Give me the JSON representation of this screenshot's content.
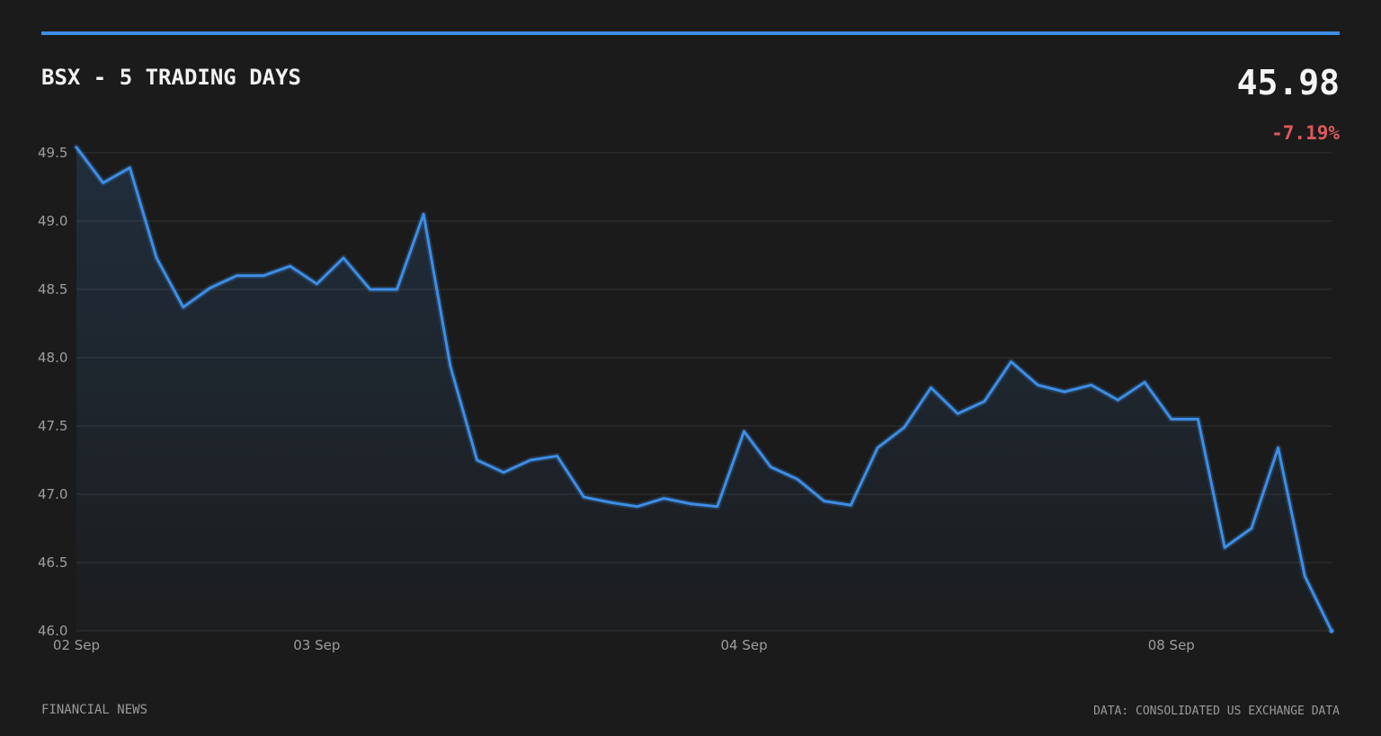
{
  "header": {
    "title": "BSX - 5 TRADING DAYS",
    "price": "45.98",
    "change": "-7.19%"
  },
  "footer": {
    "left": "FINANCIAL NEWS",
    "right": "DATA: CONSOLIDATED US EXCHANGE DATA"
  },
  "colors": {
    "background": "#1b1b1b",
    "accent": "#3d8ee6",
    "line": "#3d8ee6",
    "negative": "#e0595c",
    "grid": "#333333"
  },
  "chart_data": {
    "type": "area",
    "title": "BSX - 5 TRADING DAYS",
    "xlabel": "",
    "ylabel": "",
    "ylim": [
      46.0,
      49.5
    ],
    "yticks": [
      "46.0",
      "46.5",
      "47.0",
      "47.5",
      "48.0",
      "48.5",
      "49.0",
      "49.5"
    ],
    "xtick_labels": [
      {
        "label": "02 Sep",
        "index": 0
      },
      {
        "label": "03 Sep",
        "index": 9
      },
      {
        "label": "04 Sep",
        "index": 25
      },
      {
        "label": "08 Sep",
        "index": 41
      }
    ],
    "grid": true,
    "series": [
      {
        "values": [
          49.54,
          49.28,
          49.39,
          48.73,
          48.37,
          48.51,
          48.6,
          48.6,
          48.67,
          48.54,
          48.73,
          48.5,
          48.5,
          49.05,
          47.94,
          47.25,
          47.16,
          47.25,
          47.28,
          46.98,
          46.94,
          46.91,
          46.97,
          46.93,
          46.91,
          47.46,
          47.2,
          47.11,
          46.95,
          46.92,
          47.34,
          47.49,
          47.78,
          47.59,
          47.68,
          47.97,
          47.8,
          47.75,
          47.8,
          47.69,
          47.82,
          47.55,
          47.55,
          46.61,
          46.75,
          47.34,
          46.4,
          46.0
        ]
      }
    ]
  }
}
